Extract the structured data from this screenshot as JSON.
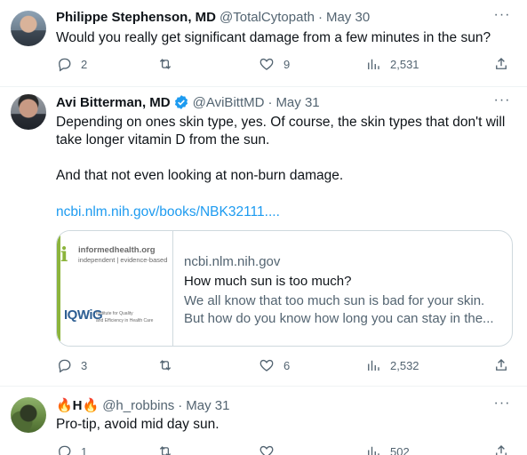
{
  "tweets": [
    {
      "name": "Philippe Stephenson, MD",
      "handle": "@TotalCytopath",
      "time": "May 30",
      "text": "Would you really get significant damage from a few minutes in the sun?",
      "replies": "2",
      "retweets": "",
      "likes": "9",
      "views": "2,531"
    },
    {
      "name": "Avi Bitterman, MD",
      "handle": "@AviBittMD",
      "time": "May 31",
      "verified": true,
      "text_lines": [
        "Depending on ones skin type, yes. Of course, the skin types that don't will",
        "take longer vitamin D from the sun.",
        "And that not even looking at non-burn damage."
      ],
      "link": "ncbi.nlm.nih.gov/books/NBK32111....",
      "card": {
        "brand_mark": "i",
        "brand_name": "informedhealth.org",
        "brand_sub": "independent | evidence-based",
        "partner_name": "IQWiG",
        "partner_sub_1": "Institute for Quality",
        "partner_sub_2": "and Efficiency in Health Care",
        "domain": "ncbi.nlm.nih.gov",
        "title": "How much sun is too much?",
        "desc_1": "We all know that too much sun is bad for your skin.",
        "desc_2": "But how do you know how long you can stay in the..."
      },
      "replies": "3",
      "retweets": "",
      "likes": "6",
      "views": "2,532"
    },
    {
      "name": "🔥H🔥",
      "handle": "@h_robbins",
      "time": "May 31",
      "text": "Pro-tip, avoid mid day sun.",
      "replies": "1",
      "retweets": "",
      "likes": "",
      "views": "502"
    }
  ],
  "icons": {
    "more": "more-icon",
    "reply": "reply-icon",
    "retweet": "retweet-icon",
    "like": "heart-icon",
    "views": "views-icon",
    "share": "share-icon",
    "verified": "verified-badge-icon"
  },
  "colors": {
    "link": "#1d9bf0",
    "secondary_text": "#536471",
    "verified": "#1d9bf0",
    "divider": "#eff3f4"
  },
  "separator": "·"
}
